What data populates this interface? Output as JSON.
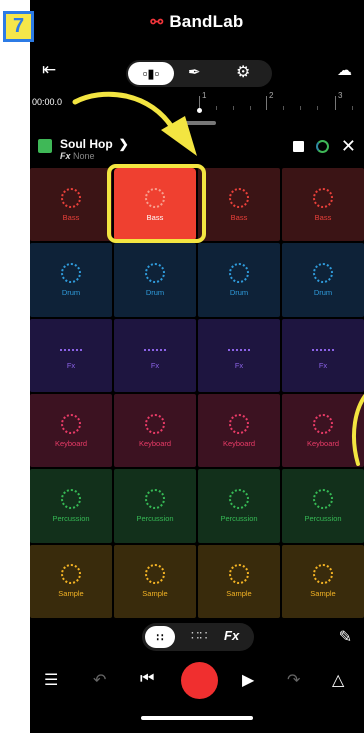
{
  "step_badge": "7",
  "app": {
    "title": "BandLab"
  },
  "timeline": {
    "time": "00:00.0",
    "markers": [
      "1",
      "2",
      "3"
    ]
  },
  "song": {
    "name": "Soul Hop",
    "fx_label": "Fx",
    "fx_value": "None"
  },
  "pads": {
    "rows": [
      {
        "label": "Bass",
        "color": "#e9403a",
        "bg": "#3b1415"
      },
      {
        "label": "Drum",
        "color": "#2f9bdb",
        "bg": "#0e2238"
      },
      {
        "label": "Fx",
        "color": "#8b62e6",
        "bg": "#1e1540"
      },
      {
        "label": "Keyboard",
        "color": "#e83b67",
        "bg": "#3c1221"
      },
      {
        "label": "Percussion",
        "color": "#36b955",
        "bg": "#12301b"
      },
      {
        "label": "Sample",
        "color": "#f3b324",
        "bg": "#392b0c"
      }
    ],
    "active": {
      "row": 0,
      "col": 1
    }
  },
  "bottom_bar": {
    "fx_label": "Fx"
  },
  "colors": {
    "accent": "#f02f2f",
    "highlight": "#f3e541",
    "badge_bg": "#f5e64a",
    "badge_border": "#2c7be5"
  }
}
